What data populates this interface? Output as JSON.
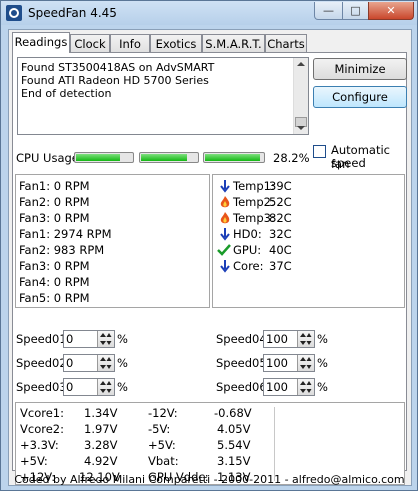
{
  "window": {
    "title": "SpeedFan 4.45",
    "min_glyph": "—",
    "max_glyph": "□",
    "close_glyph": "✕"
  },
  "tabs": [
    "Readings",
    "Clock",
    "Info",
    "Exotics",
    "S.M.A.R.T.",
    "Charts"
  ],
  "log": [
    "Found ST3500418AS on AdvSMART",
    "Found ATI Radeon HD 5700 Series",
    "End of detection"
  ],
  "buttons": {
    "minimize": "Minimize",
    "configure": "Configure"
  },
  "cpu": {
    "label": "CPU Usage",
    "value": "28.2%",
    "bars": [
      0.8,
      0.82,
      0.95
    ]
  },
  "auto_fan": {
    "label_line1": "Automatic fan",
    "label_line2": "speed",
    "checked": false
  },
  "fans": [
    "Fan1: 0 RPM",
    "Fan2: 0 RPM",
    "Fan3: 0 RPM",
    "Fan1: 2974 RPM",
    "Fan2: 983 RPM",
    "Fan3: 0 RPM",
    "Fan4: 0 RPM",
    "Fan5: 0 RPM"
  ],
  "temps": [
    {
      "label": "Temp1:",
      "value": "39C",
      "icon": "arrow-down-icon"
    },
    {
      "label": "Temp2:",
      "value": "52C",
      "icon": "flame-icon"
    },
    {
      "label": "Temp3:",
      "value": "82C",
      "icon": "flame-icon"
    },
    {
      "label": "HD0:",
      "value": "32C",
      "icon": "arrow-down-icon"
    },
    {
      "label": "GPU:",
      "value": "40C",
      "icon": "check-icon"
    },
    {
      "label": "Core:",
      "value": "37C",
      "icon": "arrow-down-icon"
    }
  ],
  "speeds": [
    {
      "label": "Speed01:",
      "value": "0"
    },
    {
      "label": "Speed02:",
      "value": "0"
    },
    {
      "label": "Speed03:",
      "value": "0"
    },
    {
      "label": "Speed04:",
      "value": "100"
    },
    {
      "label": "Speed05:",
      "value": "100"
    },
    {
      "label": "Speed06:",
      "value": "100"
    }
  ],
  "percent_sign": "%",
  "voltages_left": [
    {
      "label": "Vcore1:",
      "value": "1.34V"
    },
    {
      "label": "Vcore2:",
      "value": "1.97V"
    },
    {
      "label": "+3.3V:",
      "value": "3.28V"
    },
    {
      "label": "+5V:",
      "value": "4.92V"
    },
    {
      "label": "+12V:",
      "value": "12.10V"
    }
  ],
  "voltages_right": [
    {
      "label": "-12V:",
      "value": "-0.68V"
    },
    {
      "label": "-5V:",
      "value": "4.05V"
    },
    {
      "label": "+5V:",
      "value": "5.54V"
    },
    {
      "label": "Vbat:",
      "value": "3.15V"
    },
    {
      "label": "GPU Vddc:",
      "value": "1.13V"
    }
  ],
  "status": "Coded by Alfredo Milani Comparetti - 2000-2011 - alfredo@almico.com"
}
